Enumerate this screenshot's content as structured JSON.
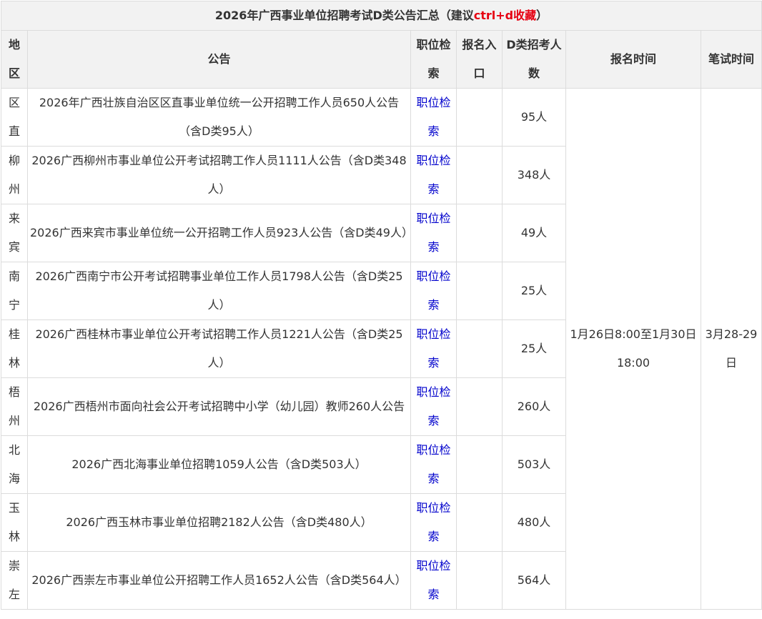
{
  "title": {
    "main": "2026年广西事业单位招聘考试D类公告汇总（建议",
    "highlight": "ctrl+d收藏",
    "tail": "）"
  },
  "headers": {
    "region": "地区",
    "notice": "公告",
    "search": "职位检索",
    "signup_entry": "报名入口",
    "d_count": "D类招考人数",
    "signup_time": "报名时间",
    "exam_time": "笔试时间"
  },
  "signup_time": "1月26日8:00至1月30日18:00",
  "exam_time": "3月28-29日",
  "rows": [
    {
      "region": "区直",
      "notice": "2026年广西壮族自治区区直事业单位统一公开招聘工作人员650人公告（含D类95人）",
      "search": "职位检索",
      "signup_entry": "",
      "count": "95人"
    },
    {
      "region": "柳州",
      "notice": "2026广西柳州市事业单位公开考试招聘工作人员1111人公告（含D类348人）",
      "search": "职位检索",
      "signup_entry": "",
      "count": "348人"
    },
    {
      "region": "来宾",
      "notice": "2026广西来宾市事业单位统一公开招聘工作人员923人公告（含D类49人）",
      "search": "职位检索",
      "signup_entry": "",
      "count": "49人"
    },
    {
      "region": "南宁",
      "notice": "2026广西南宁市公开考试招聘事业单位工作人员1798人公告（含D类25人）",
      "search": "职位检索",
      "signup_entry": "",
      "count": "25人"
    },
    {
      "region": "桂林",
      "notice": "2026广西桂林市事业单位公开考试招聘工作人员1221人公告（含D类25人）",
      "search": "职位检索",
      "signup_entry": "",
      "count": "25人"
    },
    {
      "region": "梧州",
      "notice": "2026广西梧州市面向社会公开考试招聘中小学（幼儿园）教师260人公告",
      "search": "职位检索",
      "signup_entry": "",
      "count": "260人"
    },
    {
      "region": "北海",
      "notice": "2026广西北海事业单位招聘1059人公告（含D类503人）",
      "search": "职位检索",
      "signup_entry": "",
      "count": "503人"
    },
    {
      "region": "玉林",
      "notice": "2026广西玉林市事业单位招聘2182人公告（含D类480人）",
      "search": "职位检索",
      "signup_entry": "",
      "count": "480人"
    },
    {
      "region": "崇左",
      "notice": "2026广西崇左市事业单位公开招聘工作人员1652人公告（含D类564人）",
      "search": "职位检索",
      "signup_entry": "",
      "count": "564人"
    }
  ]
}
